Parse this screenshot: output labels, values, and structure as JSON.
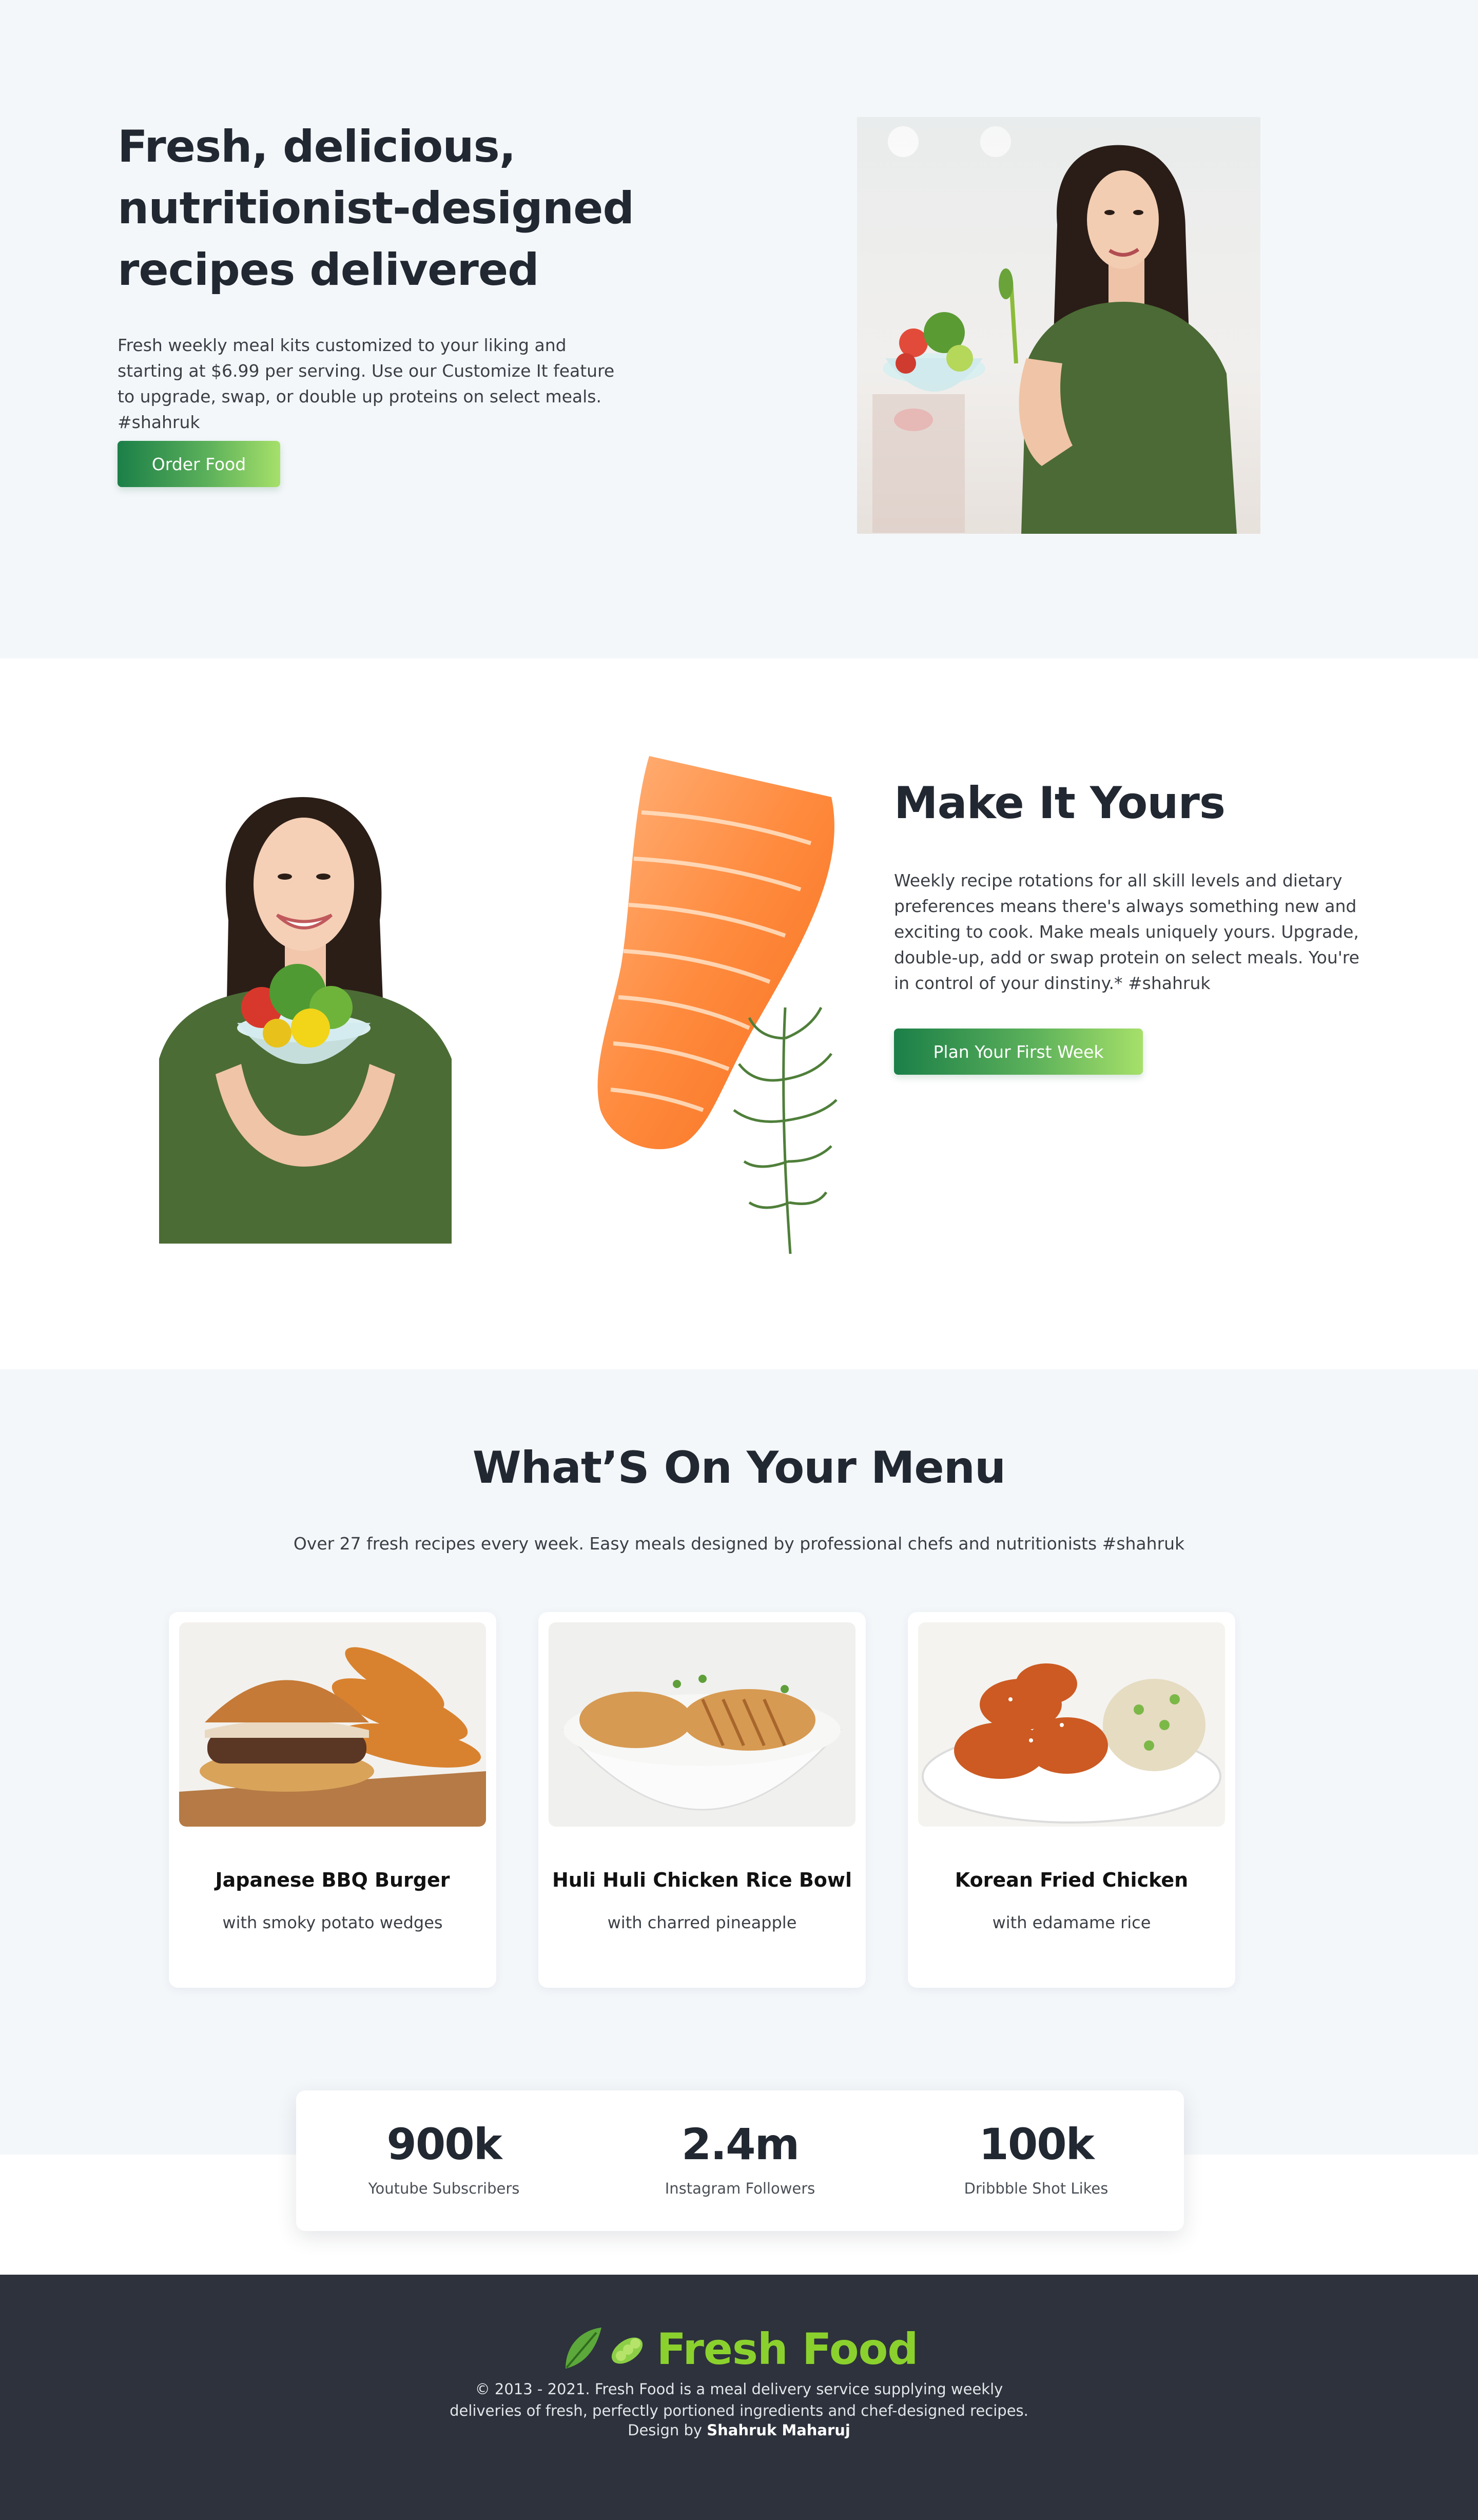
{
  "hero": {
    "title": "Fresh, delicious, nutritionist-designed recipes delivered",
    "text": "Fresh weekly meal kits customized to your liking and starting at $6.99 per serving. Use our Customize It feature to upgrade, swap, or double up proteins on select meals. #shahruk",
    "button_label": "Order Food"
  },
  "make": {
    "title": "Make It Yours",
    "text": "Weekly recipe rotations for all skill levels and dietary preferences means there's always something new and exciting to cook. Make meals uniquely yours. Upgrade, double-up, add or swap protein on select meals. You're in control of your dinstiny.* #shahruk",
    "button_label": "Plan Your First Week"
  },
  "menu": {
    "title": "What’S On Your Menu",
    "subtitle": "Over 27 fresh recipes every week. Easy meals designed by professional chefs and nutritionists #shahruk",
    "items": [
      {
        "name": "Japanese BBQ Burger",
        "desc": "with smoky potato wedges"
      },
      {
        "name": "Huli Huli Chicken Rice Bowl",
        "desc": "with charred pineapple"
      },
      {
        "name": "Korean Fried Chicken",
        "desc": "with edamame rice"
      }
    ]
  },
  "stats": [
    {
      "value": "900k",
      "label": "Youtube Subscribers"
    },
    {
      "value": "2.4m",
      "label": "Instagram Followers"
    },
    {
      "value": "100k",
      "label": "Dribbble Shot Likes"
    }
  ],
  "footer": {
    "logo_icon": "🥬 🫛",
    "logo_text": "Fresh Food",
    "text_line1": "© 2013 - 2021. Fresh Food is a meal delivery service supplying weekly",
    "text_line2": "deliveries of fresh, perfectly portioned ingredients and chef-designed recipes.",
    "credit_prefix": "Design by",
    "credit_name": "Shahruk Maharuj"
  },
  "colors": {
    "accent_green": "#8bd12d",
    "button_gradient_start": "#1b7f48",
    "button_gradient_end": "#a6e06a",
    "footer_bg": "#2d323c",
    "section_bg": "#f4f7fa"
  }
}
